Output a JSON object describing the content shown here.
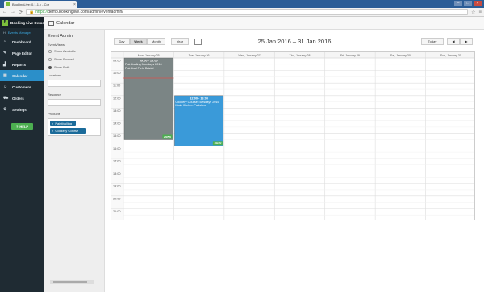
{
  "browser": {
    "tab_title": "BookingLive: 0.1.1.c - Cor",
    "tab_close": "×",
    "url_scheme": "https://",
    "url_rest": "demo.bookinglive.com/admin/eventadmin/",
    "back": "←",
    "forward": "→",
    "reload": "⟳",
    "lock": "🔒",
    "bookmark": "☆",
    "menu": "≡",
    "min": "–",
    "max": "□",
    "close": "×"
  },
  "sidebar": {
    "logo": "B",
    "brand": "Booking Live Demo",
    "hello_prefix": "Hi",
    "hello_user": "Events Manager",
    "items": [
      {
        "label": "Dashboard",
        "icon": "◔",
        "icon_name": "dashboard-icon"
      },
      {
        "label": "Page Editor",
        "icon": "✎",
        "icon_name": "edit-icon"
      },
      {
        "label": "Reports",
        "icon": "▟",
        "icon_name": "chart-icon"
      },
      {
        "label": "Calendar",
        "icon": "▦",
        "icon_name": "calendar-icon",
        "active": true
      },
      {
        "label": "Customers",
        "icon": "☺",
        "icon_name": "customers-icon"
      },
      {
        "label": "Orders",
        "icon": "⛟",
        "icon_name": "cart-icon"
      },
      {
        "label": "Settings",
        "icon": "⚙",
        "icon_name": "gear-icon"
      }
    ],
    "help_label": "HELP",
    "help_icon": "?"
  },
  "header": {
    "title": "Calendar"
  },
  "panel": {
    "title": "Event Admin",
    "event_views_label": "EventViews",
    "radios": [
      {
        "label": "Show Available",
        "checked": false
      },
      {
        "label": "Show Booked",
        "checked": false
      },
      {
        "label": "Show Both",
        "checked": true
      }
    ],
    "locations_label": "Locations",
    "resource_label": "Resource",
    "products_label": "Products",
    "products": [
      "Paintballing",
      "Cookery Course"
    ],
    "chip_remove": "×"
  },
  "toolbar": {
    "day": "Day",
    "week": "Week",
    "month": "Month",
    "year": "Year",
    "today": "Today",
    "prev": "◀",
    "next": "▶",
    "date_range": "25 Jan 2016 – 31 Jan 2016"
  },
  "calendar": {
    "days": [
      "Mon, January 25",
      "Tue, January 26",
      "Wed, January 27",
      "Thu, January 28",
      "Fri, January 29",
      "Sat, January 30",
      "Sun, January 31"
    ],
    "hours": [
      "09:00",
      "10:00",
      "11:00",
      "12:00",
      "13:00",
      "14:00",
      "15:00",
      "16:00",
      "17:00",
      "18:00",
      "19:00",
      "20:00",
      "21:00"
    ],
    "events": [
      {
        "day": 0,
        "start": 9.0,
        "end": 15.5,
        "time": "09:00 - 16:00",
        "title": "Paintballing Mondays 2016 Paintball Field Bristol",
        "count": "49/50",
        "color": "#7b8585"
      },
      {
        "day": 1,
        "start": 12.0,
        "end": 16.0,
        "time": "12:00 - 16:00",
        "title": "Cookery Course Tuesdays 2016 Main Kitchen Padstow",
        "count": "16/20",
        "color": "#3a9ad9"
      }
    ],
    "now_hour": 10.6,
    "now_color": "#d9534f",
    "badge_color": "#4caf50"
  }
}
